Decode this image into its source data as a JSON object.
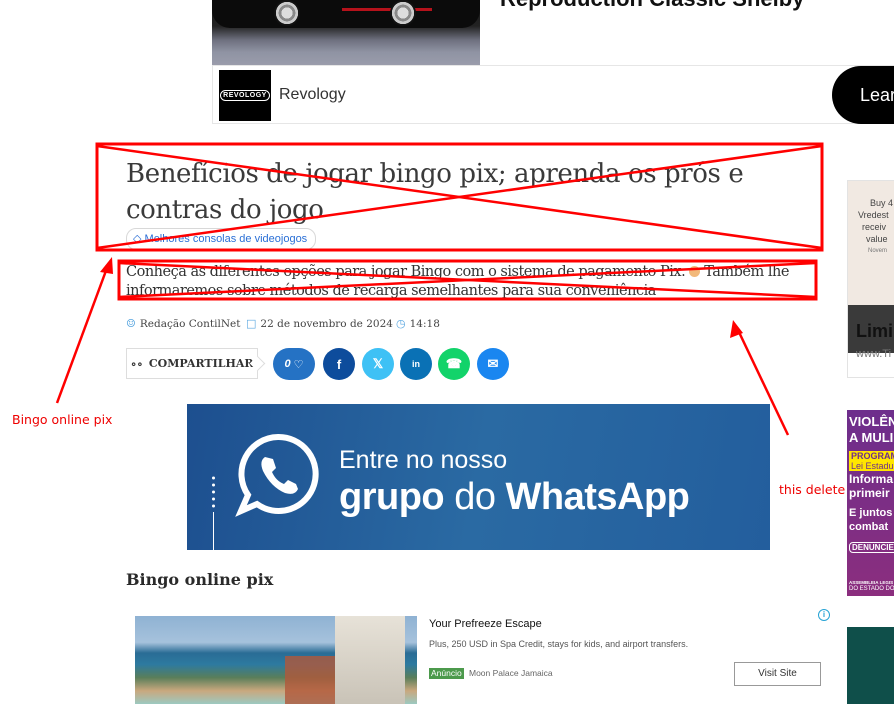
{
  "top_ad": {
    "headline": "Reproduction Classic Shelby",
    "brand_logo_text": "REVOLOGY",
    "brand_name": "Revology",
    "cta_label": "Learn"
  },
  "article": {
    "title": "Benefícios de jogar bingo pix; aprenda os prós e contras do jogo",
    "tag_label": "Melhores consolas de videojogos",
    "lead_part1": "Conheça as diferentes opções para jogar Bingo com o sistema de pagamento Pix.",
    "lead_part2": "Também lhe informaremos sobre métodos de recarga semelhantes para sua conveniência",
    "author": "Redação ContilNet",
    "date": "22 de novembro de 2024",
    "time": "14:18",
    "share_label": "COMPARTILHAR",
    "likes_count": "0",
    "share_icons": [
      "facebook-icon",
      "x-icon",
      "linkedin-icon",
      "whatsapp-icon",
      "email-icon"
    ],
    "share_colors": [
      "#0d4c9c",
      "#3ec1f5",
      "#0a71b5",
      "#12d36a",
      "#1a86f0"
    ]
  },
  "whatsapp_banner": {
    "line1": "Entre no nosso",
    "line2_bold1": "grupo",
    "line2_regular": " do ",
    "line2_bold2": "WhatsApp"
  },
  "section_heading": "Bingo online pix",
  "bottom_ad": {
    "title": "Your Prefreeze Escape",
    "description": "Plus, 250 USD in Spa Credit, stays for kids, and airport transfers.",
    "badge": "Anúncio",
    "source": "Moon Palace Jamaica",
    "cta_label": "Visit Site"
  },
  "sidebar_ads": {
    "ad1_lines": [
      "Buy 4",
      "Vredest",
      "receiv",
      "value"
    ],
    "ad1_small": "Novem",
    "ad1_headline": "Limi",
    "ad1_url": "www.Ti",
    "ad2_lines": [
      "VIOLÊN",
      "A MULI",
      "PROGRAM",
      "Lei Estadu",
      "Informa",
      "primeir",
      "E juntos",
      "combat",
      "DENUNCIE!",
      "ASSEMBLEIA LEGIS",
      "DO ESTADO DO"
    ]
  },
  "annotations": {
    "left_note": "Bingo online pix",
    "right_note": "this delete",
    "color": "#ff0000"
  }
}
